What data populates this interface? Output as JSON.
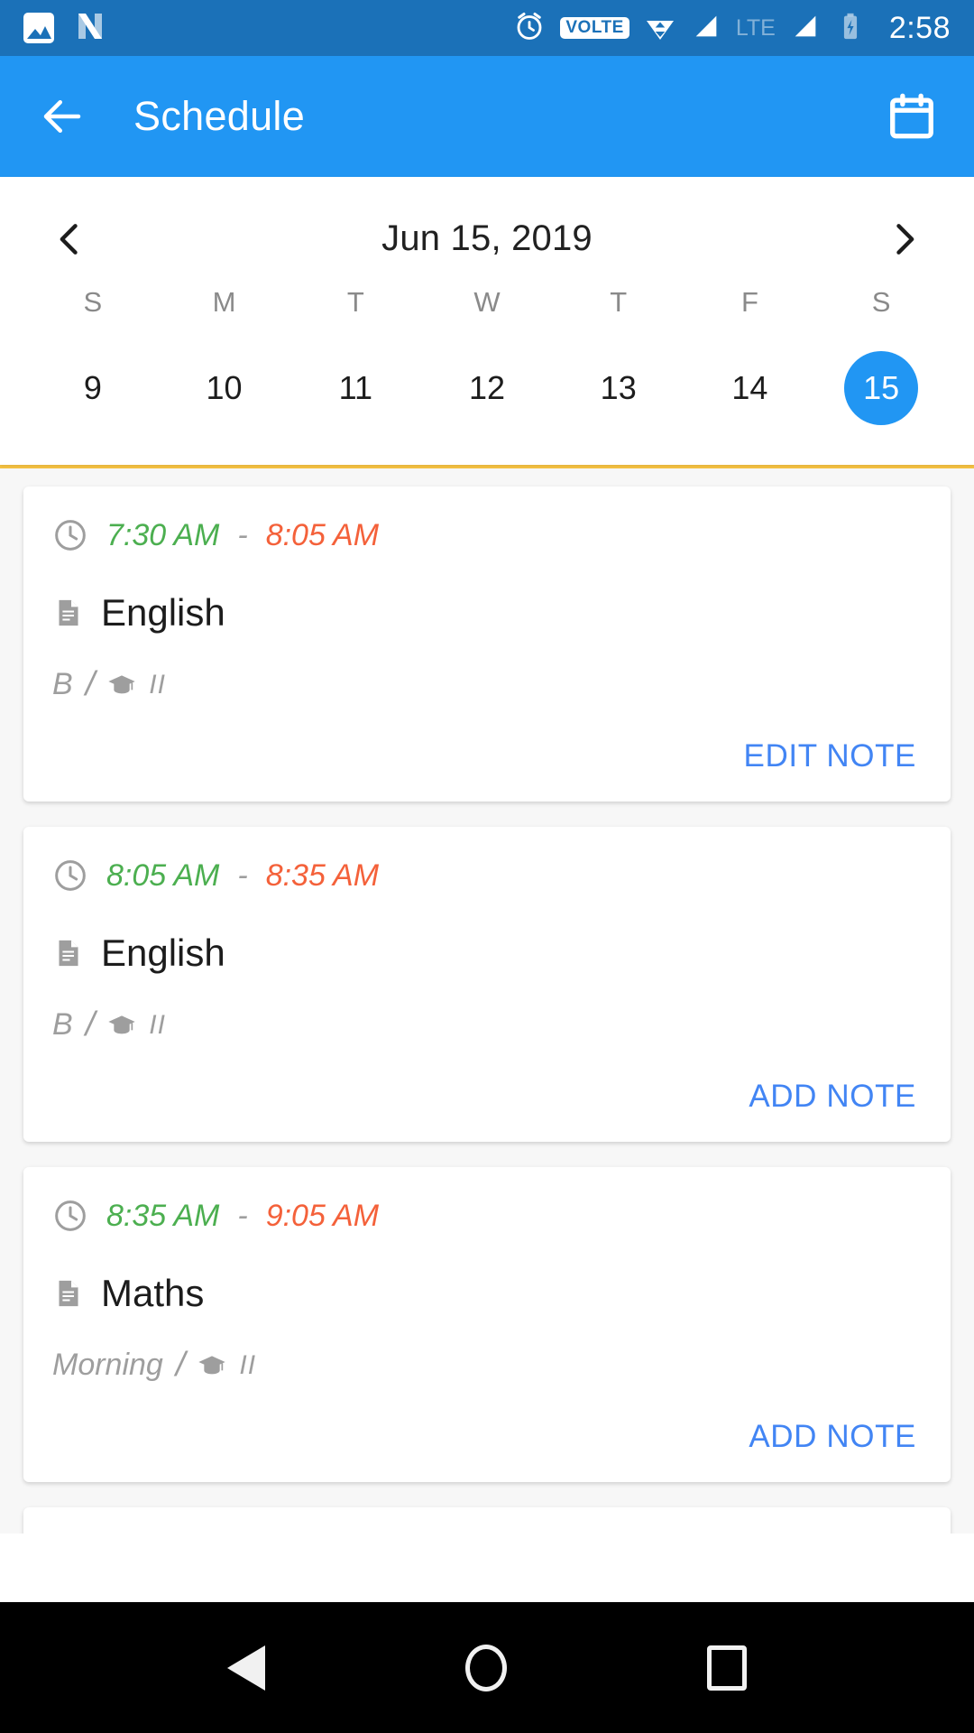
{
  "status_bar": {
    "time": "2:58",
    "left_icons": [
      "photo-icon",
      "android-nougat-icon"
    ],
    "right_icons": [
      "alarm-icon",
      "volte-icon",
      "wifi-icon",
      "signal-icon",
      "lte-icon",
      "signal-2-icon",
      "battery-charging-icon"
    ],
    "volte_label": "VOLTE",
    "lte_label": "LTE",
    "background": "#1b71b8"
  },
  "app_bar": {
    "back_icon": "arrow-back-icon",
    "title": "Schedule",
    "calendar_icon": "calendar-icon",
    "background": "#2196f3"
  },
  "date_header": {
    "prev_icon": "chevron-left-icon",
    "next_icon": "chevron-right-icon",
    "current_date": "Jun 15, 2019",
    "weekdays": [
      "S",
      "M",
      "T",
      "W",
      "T",
      "F",
      "S"
    ],
    "days": [
      "9",
      "10",
      "11",
      "12",
      "13",
      "14",
      "15"
    ],
    "selected_day": "15",
    "selected_index": 6,
    "selected_color": "#2196f3",
    "divider_color": "#f5c242"
  },
  "schedule": {
    "clock_icon": "clock-icon",
    "doc_icon": "document-icon",
    "cap_icon": "graduation-cap-icon",
    "separator": "/",
    "dash": "-",
    "tail": "II",
    "items": [
      {
        "start_time": "7:30 AM",
        "end_time": "8:05 AM",
        "subject": "English",
        "meta_label": "B",
        "action_label": "EDIT NOTE"
      },
      {
        "start_time": "8:05 AM",
        "end_time": "8:35 AM",
        "subject": "English",
        "meta_label": "B",
        "action_label": "ADD NOTE"
      },
      {
        "start_time": "8:35 AM",
        "end_time": "9:05 AM",
        "subject": "Maths",
        "meta_label": "Morning",
        "action_label": "ADD NOTE"
      }
    ],
    "start_color": "#4caf50",
    "end_color": "#f4613a",
    "action_color": "#4285f4"
  },
  "nav_bar": {
    "back_icon": "nav-back-icon",
    "home_icon": "nav-home-icon",
    "recent_icon": "nav-recent-icon"
  }
}
